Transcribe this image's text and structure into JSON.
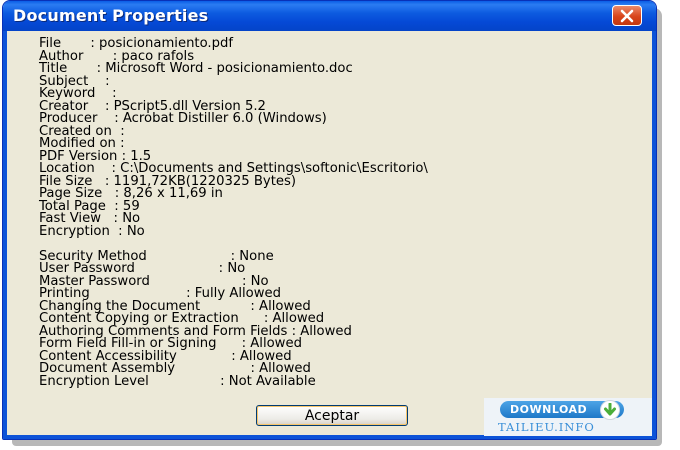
{
  "window": {
    "title": "Document Properties"
  },
  "properties": [
    "File       : posicionamiento.pdf",
    "Author       : paco rafols",
    "Title       : Microsoft Word - posicionamiento.doc",
    "Subject    :",
    "Keyword    :",
    "Creator    : PScript5.dll Version 5.2",
    "Producer    : Acrobat Distiller 6.0 (Windows)",
    "Created on  :",
    "Modified on :",
    "PDF Version : 1.5",
    "Location    : C:\\Documents and Settings\\softonic\\Escritorio\\",
    "File Size   : 1191,72KB(1220325 Bytes)",
    "Page Size   : 8,26 x 11,69 in",
    "Total Page  : 59",
    "Fast View   : No",
    "Encryption  : No"
  ],
  "security": [
    "Security Method                    : None",
    "User Password                    : No",
    "Master Password                      : No",
    "Printing                       : Fully Allowed",
    "Changing the Document            : Allowed",
    "Content Copying or Extraction      : Allowed",
    "Authoring Comments and Form Fields : Allowed",
    "Form Field Fill-in or Signing      : Allowed",
    "Content Accessibility             : Allowed",
    "Document Assembly                  : Allowed",
    "Encryption Level                 : Not Available"
  ],
  "buttons": {
    "ok_label": "Aceptar"
  },
  "watermark": {
    "download_label": "DOWNLOAD",
    "site_label": "TAILIEU.INFO"
  },
  "colors": {
    "titlebar": "#0549d6",
    "window_bg": "#ece9d8",
    "close_button": "#d9451b"
  }
}
